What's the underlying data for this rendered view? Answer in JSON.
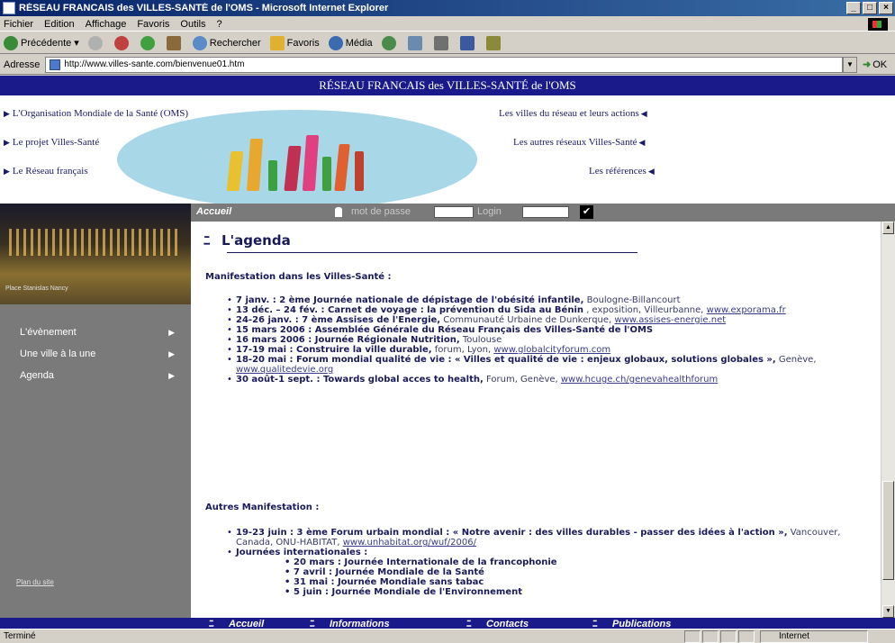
{
  "window": {
    "title": "RÉSEAU FRANCAIS des VILLES-SANTÉ de l'OMS - Microsoft Internet Explorer",
    "controls": [
      "_",
      "□",
      "×"
    ]
  },
  "menu": [
    "Fichier",
    "Edition",
    "Affichage",
    "Favoris",
    "Outils",
    "?"
  ],
  "toolbar": {
    "back": "Précédente",
    "search": "Rechercher",
    "favorites": "Favoris",
    "media": "Média"
  },
  "address": {
    "label": "Adresse",
    "url": "http://www.villes-sante.com/bienvenue01.htm",
    "go": "OK"
  },
  "site": {
    "title": "RÉSEAU FRANCAIS des VILLES-SANTÉ de l'OMS",
    "left_nav": [
      "L'Organisation Mondiale de la Santé (OMS)",
      "Le projet Villes-Santé",
      "Le Réseau français"
    ],
    "right_nav": [
      "Les villes du réseau et leurs actions",
      "Les autres réseaux Villes-Santé",
      "Les références"
    ]
  },
  "sidebar": {
    "caption": "Place Stanislas Nancy",
    "items": [
      "L'évènement",
      "Une ville à la une",
      "Agenda"
    ],
    "plan": "Plan du site"
  },
  "login": {
    "home": "Accueil",
    "password_label": "mot de passe",
    "login_label": "Login"
  },
  "agenda": {
    "title": "L'agenda",
    "section1": "Manifestation dans les Villes-Santé :",
    "events1": [
      {
        "bold": "7 janv. : 2 ème Journée nationale de dépistage de l'obésité infantile,",
        "rest": " Boulogne-Billancourt",
        "link": ""
      },
      {
        "bold": "13 déc. – 24 fév. : Carnet de voyage : la prévention du Sida au Bénin",
        "rest": " , exposition, Villeurbanne, ",
        "link": "www.exporama.fr"
      },
      {
        "bold": "24-26 janv. : 7 ème Assises de l'Energie,",
        "rest": " Communauté Urbaine de Dunkerque, ",
        "link": "www.assises-energie.net"
      },
      {
        "bold": "15 mars 2006 : Assemblée Générale du Réseau Français des Villes-Santé de l'OMS",
        "rest": "",
        "link": ""
      },
      {
        "bold": "16 mars 2006 : Journée Régionale Nutrition,",
        "rest": " Toulouse",
        "link": ""
      },
      {
        "bold": "17-19 mai : Construire la ville durable,",
        "rest": " forum, Lyon, ",
        "link": "www.globalcityforum.com"
      },
      {
        "bold": "18-20 mai : Forum mondial qualité de vie : « Villes et qualité de vie : enjeux globaux, solutions globales »,",
        "rest": " Genève, ",
        "link": "www.qualitedevie.org"
      },
      {
        "bold": "30 août-1 sept. : Towards global acces to health,",
        "rest": " Forum, Genève, ",
        "link": "www.hcuge.ch/genevahealthforum"
      }
    ],
    "section2": "Autres Manifestation :",
    "events2": [
      {
        "bold": "19-23 juin : 3 ème Forum urbain mondial : « Notre avenir : des villes durables - passer des idées à l'action »,",
        "rest": " Vancouver, Canada, ONU-HABITAT, ",
        "link": "www.unhabitat.org/wuf/2006/"
      },
      {
        "bold": "Journées internationales :",
        "rest": "",
        "link": ""
      }
    ],
    "journees": [
      "20 mars : Journée Internationale de la francophonie",
      "7 avril : Journée Mondiale de la Santé",
      "31 mai : Journée Mondiale sans tabac",
      "5 juin : Journée Mondiale de l'Environnement"
    ]
  },
  "footer": [
    "Accueil",
    "Informations",
    "Contacts",
    "Publications"
  ],
  "status": {
    "left": "Terminé",
    "zone": "Internet"
  }
}
